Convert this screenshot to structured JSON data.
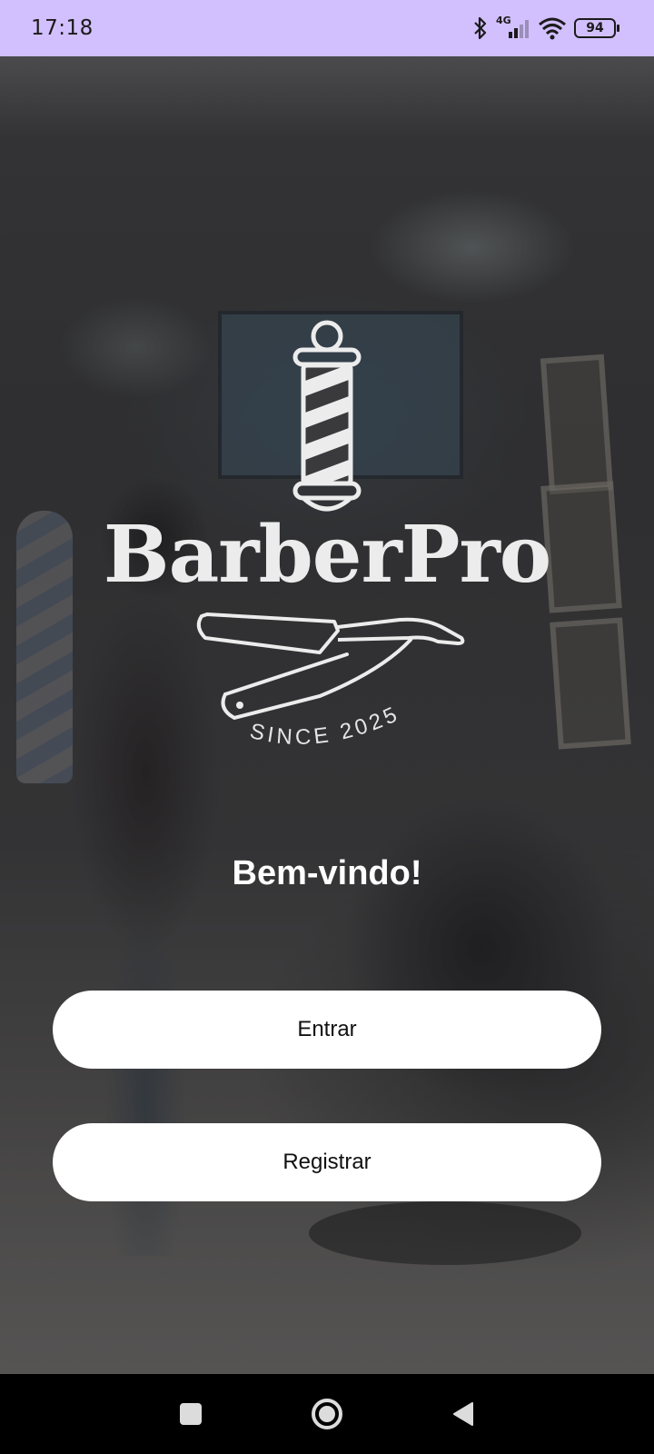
{
  "status_bar": {
    "time": "17:18",
    "network_label": "4G",
    "battery_level": "94",
    "icons": [
      "bluetooth-icon",
      "signal-icon",
      "wifi-icon",
      "battery-icon"
    ]
  },
  "brand": {
    "name": "BarberPro",
    "tagline": "SINCE 2025",
    "icons": [
      "barber-pole-icon",
      "straight-razor-icon"
    ]
  },
  "welcome": {
    "title": "Bem-vindo!"
  },
  "actions": {
    "login_label": "Entrar",
    "register_label": "Registrar"
  },
  "navigation_bar": {
    "items": [
      "recents-square-icon",
      "home-circle-icon",
      "back-triangle-icon"
    ]
  },
  "colors": {
    "status_bar_bg": "#d2bffd",
    "button_bg": "#ffffff",
    "text_light": "#ececec"
  }
}
